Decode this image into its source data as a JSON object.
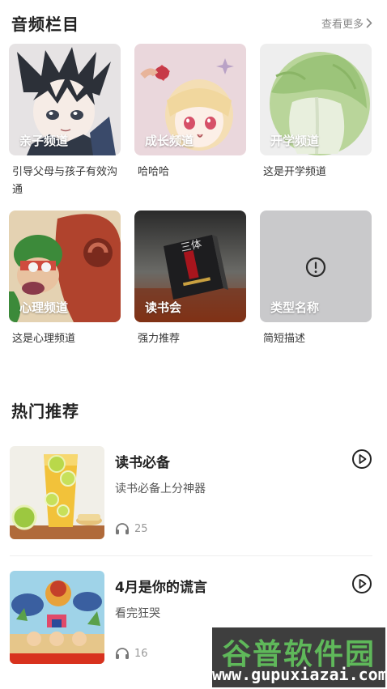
{
  "audio_section": {
    "title": "音频栏目",
    "more_label": "查看更多",
    "items": [
      {
        "label": "亲子频道",
        "desc": "引导父母与孩子有效沟通"
      },
      {
        "label": "成长频道",
        "desc": "哈哈哈"
      },
      {
        "label": "开学频道",
        "desc": "这是开学频道"
      },
      {
        "label": "心理频道",
        "desc": "这是心理频道"
      },
      {
        "label": "读书会",
        "desc": "强力推荐"
      },
      {
        "label": "类型名称",
        "desc": "简短描述"
      }
    ]
  },
  "hot_section": {
    "title": "热门推荐",
    "items": [
      {
        "title": "读书必备",
        "subtitle": "读书必备上分神器",
        "listens": "25"
      },
      {
        "title": "4月是你的谎言",
        "subtitle": "看完狂哭",
        "listens": "16"
      }
    ]
  },
  "book_cover_text": "三体",
  "watermark": {
    "cn": "谷普软件园",
    "en": "www.gupuxiazai.com"
  },
  "colors": {
    "placeholder_gray": "#c9c9cb",
    "text_dark": "#222222",
    "text_muted": "#999999"
  }
}
